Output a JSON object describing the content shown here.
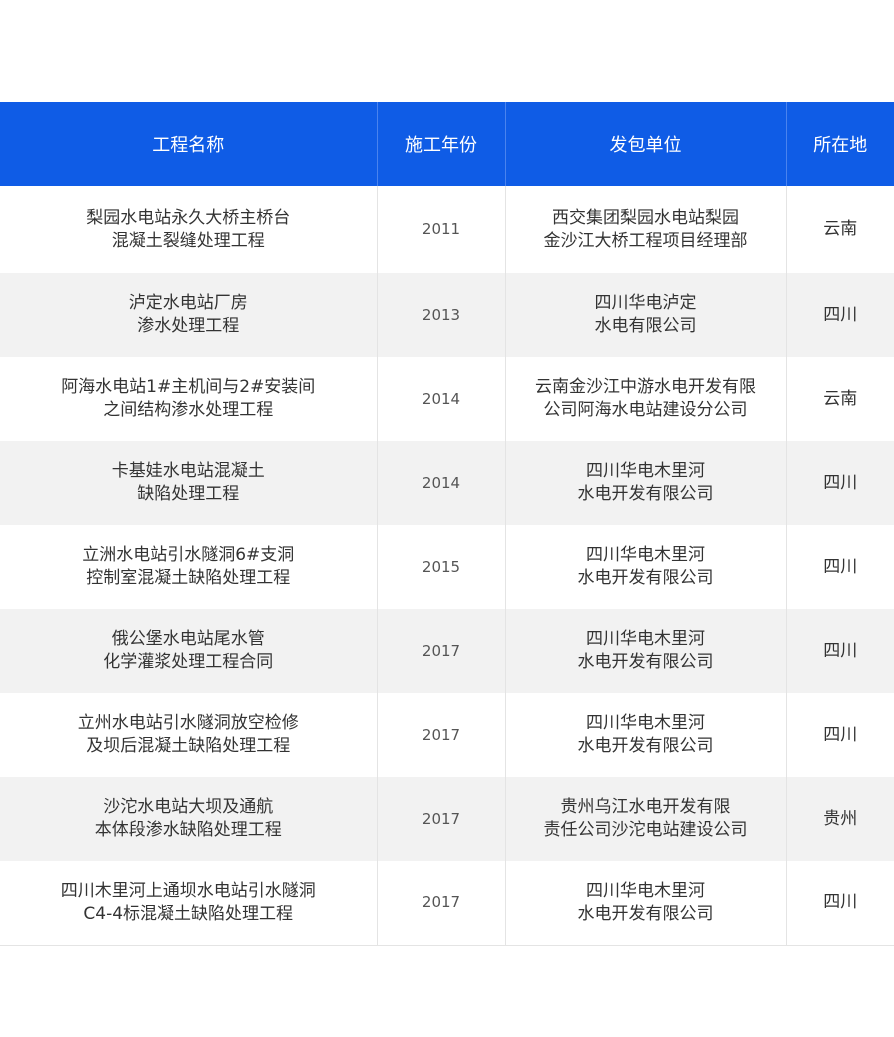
{
  "table": {
    "headers": [
      "工程名称",
      "施工年份",
      "发包单位",
      "所在地"
    ],
    "rows": [
      {
        "name": [
          "梨园水电站永久大桥主桥台",
          "混凝土裂缝处理工程"
        ],
        "year": "2011",
        "client": [
          "西交集团梨园水电站梨园",
          "金沙江大桥工程项目经理部"
        ],
        "location": "云南"
      },
      {
        "name": [
          "泸定水电站厂房",
          "渗水处理工程"
        ],
        "year": "2013",
        "client": [
          "四川华电泸定",
          "水电有限公司"
        ],
        "location": "四川"
      },
      {
        "name": [
          "阿海水电站1#主机间与2#安装间",
          "之间结构渗水处理工程"
        ],
        "year": "2014",
        "client": [
          "云南金沙江中游水电开发有限",
          "公司阿海水电站建设分公司"
        ],
        "location": "云南"
      },
      {
        "name": [
          "卡基娃水电站混凝土",
          "缺陷处理工程"
        ],
        "year": "2014",
        "client": [
          "四川华电木里河",
          "水电开发有限公司"
        ],
        "location": "四川"
      },
      {
        "name": [
          "立洲水电站引水隧洞6#支洞",
          "控制室混凝土缺陷处理工程"
        ],
        "year": "2015",
        "client": [
          "四川华电木里河",
          "水电开发有限公司"
        ],
        "location": "四川"
      },
      {
        "name": [
          "俄公堡水电站尾水管",
          "化学灌浆处理工程合同"
        ],
        "year": "2017",
        "client": [
          "四川华电木里河",
          "水电开发有限公司"
        ],
        "location": "四川"
      },
      {
        "name": [
          "立州水电站引水隧洞放空检修",
          "及坝后混凝土缺陷处理工程"
        ],
        "year": "2017",
        "client": [
          "四川华电木里河",
          "水电开发有限公司"
        ],
        "location": "四川"
      },
      {
        "name": [
          "沙沱水电站大坝及通航",
          "本体段渗水缺陷处理工程"
        ],
        "year": "2017",
        "client": [
          "贵州乌江水电开发有限",
          "责任公司沙沱电站建设公司"
        ],
        "location": "贵州"
      },
      {
        "name": [
          "四川木里河上通坝水电站引水隧洞",
          "C4-4标混凝土缺陷处理工程"
        ],
        "year": "2017",
        "client": [
          "四川华电木里河",
          "水电开发有限公司"
        ],
        "location": "四川"
      }
    ]
  },
  "colors": {
    "header_bg": "#0f5ce6",
    "header_text": "#ffffff",
    "stripe_bg": "#f2f2f2",
    "body_text": "#333333"
  }
}
